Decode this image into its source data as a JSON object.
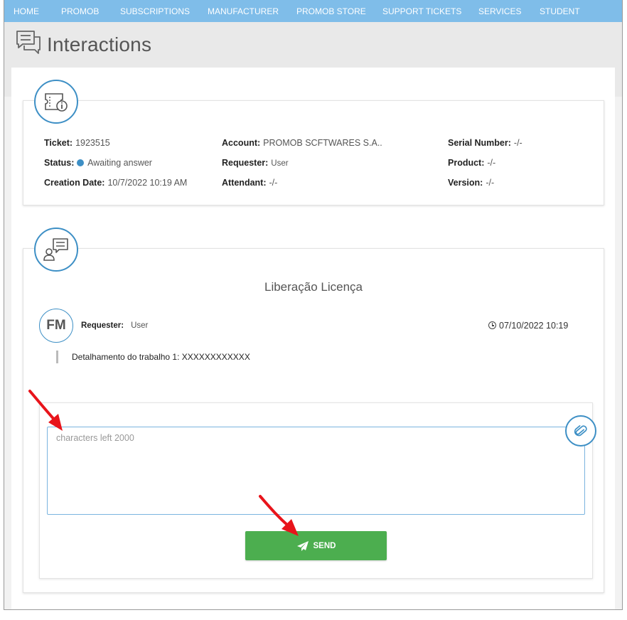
{
  "nav": [
    "HOME",
    "PROMOB",
    "SUBSCRIPTIONS",
    "MANUFACTURER",
    "PROMOB STORE",
    "SUPPORT TICKETS",
    "SERVICES",
    "STUDENT"
  ],
  "page": {
    "title": "Interactions",
    "title_icon": "chat-bubbles-icon"
  },
  "ticket": {
    "icon": "ticket-info-icon",
    "ticket_label": "Ticket:",
    "ticket_value": "1923515",
    "status_label": "Status:",
    "status_value": "Awaiting answer",
    "status_color": "#3d8fc5",
    "creation_label": "Creation Date:",
    "creation_value": "10/7/2022 10:19 AM",
    "account_label": "Account:",
    "account_value": "PROMOB SCFTWARES S.A..",
    "requester_label": "Requester:",
    "requester_value": "User",
    "attendant_label": "Attendant:",
    "attendant_value": "-/-",
    "serial_label": "Serial Number:",
    "serial_value": "-/-",
    "product_label": "Product:",
    "product_value": "-/-",
    "version_label": "Version:",
    "version_value": "-/-"
  },
  "conversation": {
    "icon": "user-chat-icon",
    "subject": "Liberação Licença",
    "message": {
      "avatar_initials": "FM",
      "requester_label": "Requester:",
      "requester_value": "User",
      "timestamp": "07/10/2022 10:19",
      "body": "Detalhamento do trabalho 1: XXXXXXXXXXXX"
    }
  },
  "reply": {
    "placeholder": "characters left 2000",
    "attach_icon": "paperclip-icon",
    "send_label": "SEND",
    "send_icon": "paper-plane-icon"
  },
  "colors": {
    "nav_bg": "#7fbde9",
    "accent": "#3d8fc5",
    "send_bg": "#4cae4f",
    "annotation_arrow": "#e8141b"
  }
}
